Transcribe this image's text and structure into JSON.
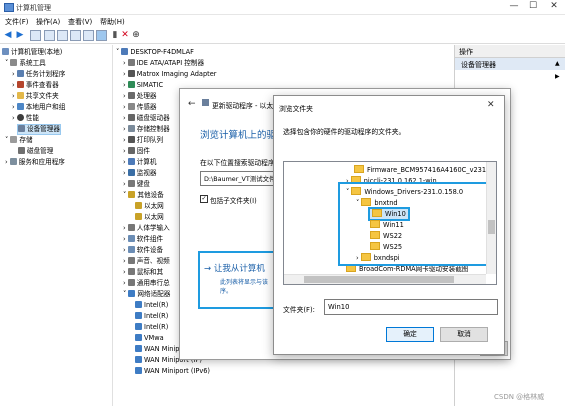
{
  "window": {
    "title": "计算机管理",
    "minimize": "—",
    "maximize": "☐",
    "close": "✕"
  },
  "menu": [
    "文件(F)",
    "操作(A)",
    "查看(V)",
    "帮助(H)"
  ],
  "left_tree": {
    "root": "计算机管理(本地)",
    "system_tools": "系统工具",
    "items": [
      "任务计划程序",
      "事件查看器",
      "共享文件夹",
      "本地用户和组",
      "性能",
      "设备管理器"
    ],
    "storage": "存储",
    "disk_mgmt": "磁盘管理",
    "services": "服务和应用程序"
  },
  "device_tree": {
    "root": "DESKTOP-F4DMLAF",
    "items": [
      "IDE ATA/ATAPI 控制器",
      "Matrox Imaging Adapter",
      "SIMATIC",
      "处理器",
      "传感器",
      "磁盘驱动器",
      "存储控制器",
      "打印队列",
      "固件",
      "计算机",
      "监视器",
      "键盘",
      "其他设备",
      "以太网",
      "以太网",
      "人体学输入",
      "软件组件",
      "软件设备",
      "声音、视频",
      "鼠标和其",
      "通用串行总",
      "网络适配器",
      "Intel(R)",
      "Intel(R)",
      "Intel(R)",
      "VMwa",
      "WAN Miniport (IKEv2)",
      "WAN Miniport (IP)",
      "WAN Miniport (IPv6)"
    ]
  },
  "actions": {
    "header": "操作",
    "device_manager": "设备管理器",
    "arrow": "▲",
    "more": "▶"
  },
  "update_dialog": {
    "title": "更新驱动程序 - 以太",
    "heading": "浏览计算机上的驱",
    "search_label": "在以下位置搜索驱动程序:",
    "path_value": "D:\\Baumer_VT测试文件",
    "include_subfolders": "包括子文件夹(I)",
    "let_me_pick": "→ 让我从计算机",
    "let_me_pick_desc1": "此列表将显示与该",
    "let_me_pick_desc2": "序。",
    "cancel_fragment": "取消"
  },
  "browse_dialog": {
    "title": "浏览文件夹",
    "instruction": "选择包含你的硬件的驱动程序的文件夹。",
    "folders": [
      "Firmware_BCM957416A4160C_v231",
      "niccli-231.0.162.1-win",
      "Windows_Drivers-231.0.158.0",
      "bnxtnd",
      "Win10",
      "Win11",
      "WS22",
      "WS25",
      "bxndspi",
      "BroadCom-RDMA网卡驱动安装截图"
    ],
    "folder_label": "文件夹(F):",
    "folder_value": "Win10",
    "ok": "确定",
    "cancel": "取消"
  },
  "watermark": "CSDN @格林威"
}
